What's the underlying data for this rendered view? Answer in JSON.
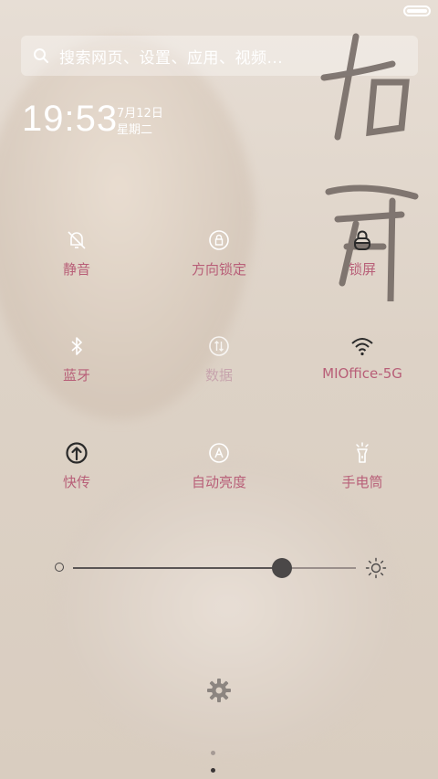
{
  "search": {
    "placeholder": "搜索网页、设置、应用、视频..."
  },
  "clock": {
    "time": "19:53",
    "date": "7月12日",
    "weekday": "星期二"
  },
  "tiles": [
    {
      "label": "静音",
      "icon": "bell-off-icon",
      "state": "on"
    },
    {
      "label": "方向锁定",
      "icon": "rotation-lock-icon",
      "state": "on"
    },
    {
      "label": "锁屏",
      "icon": "lock-icon",
      "state": "on"
    },
    {
      "label": "蓝牙",
      "icon": "bluetooth-icon",
      "state": "on"
    },
    {
      "label": "数据",
      "icon": "mobile-data-icon",
      "state": "disabled"
    },
    {
      "label": "MIOffice-5G",
      "icon": "wifi-icon",
      "state": "on"
    },
    {
      "label": "快传",
      "icon": "quick-share-icon",
      "state": "on"
    },
    {
      "label": "自动亮度",
      "icon": "auto-brightness-icon",
      "state": "on"
    },
    {
      "label": "手电筒",
      "icon": "flashlight-icon",
      "state": "on"
    }
  ],
  "brightness": {
    "level": 0.74
  },
  "pager": {
    "pages": 2,
    "current": 2
  },
  "colors": {
    "label": "#b85f78",
    "label_disabled": "#c7a4ad",
    "icon": "#2a2a2a"
  }
}
